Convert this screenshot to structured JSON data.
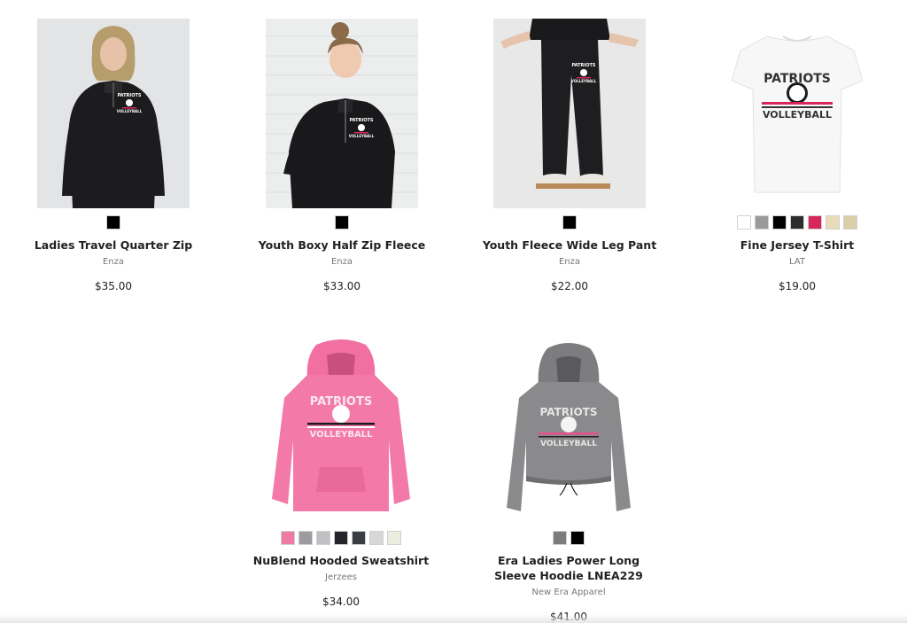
{
  "products": [
    {
      "name": "Ladies Travel Quarter Zip",
      "brand": "Enza",
      "price": "$35.00",
      "swatches": [
        "#000000"
      ]
    },
    {
      "name": "Youth Boxy Half Zip Fleece",
      "brand": "Enza",
      "price": "$33.00",
      "swatches": [
        "#000000"
      ]
    },
    {
      "name": "Youth Fleece Wide Leg Pant",
      "brand": "Enza",
      "price": "$22.00",
      "swatches": [
        "#000000"
      ]
    },
    {
      "name": "Fine Jersey T-Shirt",
      "brand": "LAT",
      "price": "$19.00",
      "swatches": [
        "#ffffff",
        "#9a9a9a",
        "#000000",
        "#2d2d2d",
        "#d6265b",
        "#e8dcb8",
        "#d9cfa8"
      ]
    },
    {
      "name": "NuBlend Hooded Sweatshirt",
      "brand": "Jerzees",
      "price": "$34.00",
      "swatches": [
        "#f07aa6",
        "#9d9aa0",
        "#bfc0c4",
        "#23252b",
        "#3a3d44",
        "#d7d7d7",
        "#ececdf"
      ]
    },
    {
      "name": "Era Ladies Power Long Sleeve Hoodie LNEA229",
      "brand": "New Era Apparel",
      "price": "$41.00",
      "swatches": [
        "#7c7c7c",
        "#000000"
      ]
    }
  ],
  "graphics": {
    "logo_line1": "PATRIOTS",
    "logo_line2": "VOLLEYBALL"
  }
}
